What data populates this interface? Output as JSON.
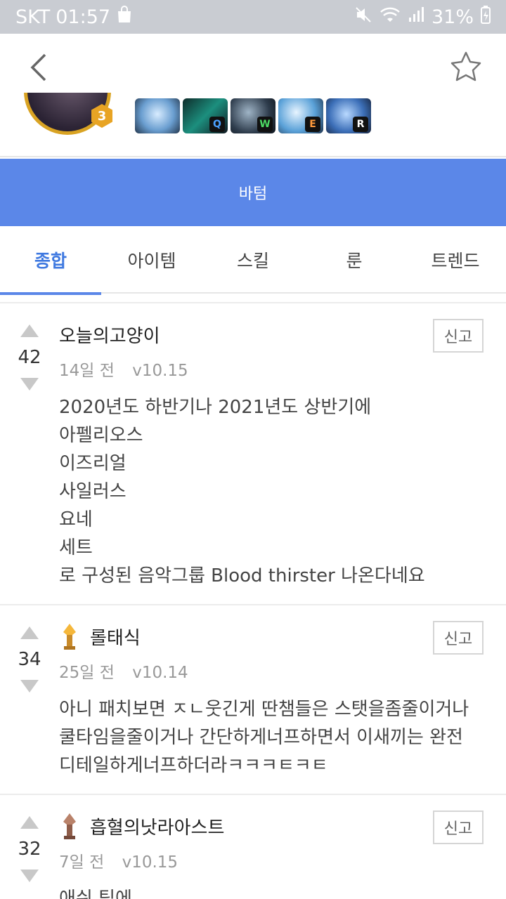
{
  "status_bar": {
    "carrier": "SKT",
    "time": "01:57",
    "battery": "31%"
  },
  "header": {
    "back_icon": "chevron-left-icon",
    "favorite_icon": "star-outline-icon"
  },
  "champion": {
    "level": "3",
    "skills": [
      "passive",
      "Q",
      "W",
      "E",
      "R"
    ]
  },
  "banner": {
    "label": "바텀"
  },
  "tabs": [
    {
      "label": "종합",
      "active": true
    },
    {
      "label": "아이템"
    },
    {
      "label": "스킬"
    },
    {
      "label": "룬"
    },
    {
      "label": "트렌드"
    }
  ],
  "colors": {
    "accent": "#5b87e8",
    "active_tab_text": "#3f79e0"
  },
  "comments": [
    {
      "votes": "42",
      "author": "오늘의고양이",
      "date": "14일 전",
      "version": "v10.15",
      "report_label": "신고",
      "lines": [
        "2020년도 하반기나 2021년도 상반기에",
        "아펠리오스",
        "이즈리얼",
        "사일러스",
        "요네",
        "세트",
        "로 구성된 음악그룹 Blood thirster 나온다네요"
      ]
    },
    {
      "votes": "34",
      "author": "롤태식",
      "date": "25일 전",
      "version": "v10.14",
      "report_label": "신고",
      "tier_icon": "gold-tier-icon",
      "lines": [
        "아니 패치보면 ㅈㄴ웃긴게 딴챔들은 스탯을좀줄이거나",
        "쿨타임을줄이거나 간단하게너프하면서 이새끼는 완전",
        "디테일하게너프하더라ㅋㅋㅋㅌㅋㅌ"
      ]
    },
    {
      "votes": "32",
      "author": "흡혈의낫라아스트",
      "date": "7일 전",
      "version": "v10.15",
      "report_label": "신고",
      "tier_icon": "bronze-tier-icon",
      "lines": [
        "애쉬 팁에"
      ]
    }
  ]
}
